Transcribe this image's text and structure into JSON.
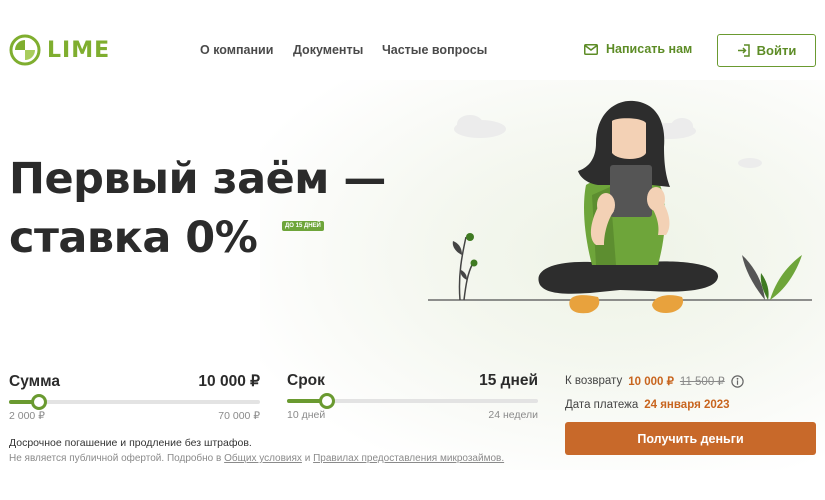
{
  "header": {
    "logo_text": "LIME",
    "nav": [
      "О компании",
      "Документы",
      "Частые вопросы"
    ],
    "write_us": "Написать нам",
    "login": "Войти",
    "icons": {
      "logo": "lime-logo-icon",
      "mail": "mail-icon",
      "login": "login-icon"
    }
  },
  "hero": {
    "title_line1": "Первый заём —",
    "title_line2": "ставка 0%",
    "badge": "ДО 15 ДНЕЙ"
  },
  "calculator": {
    "sum": {
      "label": "Сумма",
      "value": "10 000 ₽",
      "min": "2 000 ₽",
      "max": "70 000 ₽",
      "position": 0.12
    },
    "term": {
      "label": "Срок",
      "value": "15 дней",
      "min": "10 дней",
      "max": "24 недели",
      "position": 0.16
    },
    "summary": {
      "repay_label": "К возврату",
      "repay_value": "10 000 ₽",
      "repay_old": "11 500 ₽",
      "date_label": "Дата платежа",
      "date_value": "24 января 2023"
    },
    "cta": "Получить деньги",
    "note_line1": "Досрочное погашение и продление без штрафов.",
    "note_line2_prefix": "Не является публичной офертой. Подробно в",
    "note_link1": "Общих условиях",
    "note_and": "и",
    "note_link2": "Правилах предоставления микрозаймов."
  },
  "colors": {
    "brand_green": "#6a9a30",
    "accent_orange": "#c8692a",
    "text_dark": "#2b2b2b"
  }
}
